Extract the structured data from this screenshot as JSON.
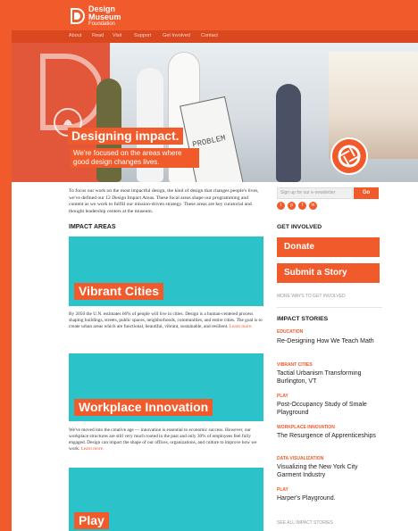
{
  "brand": {
    "logo_line1": "Design",
    "logo_line2": "Museum",
    "logo_line3": "Foundation",
    "accent": "#f15a2a",
    "teal": "#2bc3c9"
  },
  "nav": {
    "items": [
      "About",
      "Read",
      "Visit",
      "Support",
      "Get Involved",
      "Contact"
    ]
  },
  "hero": {
    "title": "Designing impact.",
    "subtitle": "We're focused on the areas where good design changes lives.",
    "board_text": "PROBLEM"
  },
  "intro": "To focus our work on the most impactful design, the kind of design that changes people's lives, we've defined our 12 Design Impact Areas. These focal areas shape our programming and content as we work to fulfill our mission-driven strategy. These areas are key curatorial and thought leadership centers at the museum.",
  "impact": {
    "heading": "IMPACT AREAS",
    "cards": [
      {
        "title": "Vibrant Cities",
        "text": "By 2050 the U.N. estimates 66% of people will live in cities. Design is a human-centered process shaping buildings, streets, public spaces, neighborhoods, communities, and entire cities. The goal is to create urban areas which are functional, beautiful, vibrant, sustainable, and resilient.",
        "link": "Learn more."
      },
      {
        "title": "Workplace Innovation",
        "text": "We've moved into the creative age — innovation is essential to economic success. However, our workplace structures are still very much rooted in the past and only 30% of employees feel fully engaged. Design can impact the shape of our offices, organizations, and culture to improve how we work.",
        "link": "Learn more."
      },
      {
        "title": "Play",
        "text": "",
        "link": ""
      }
    ]
  },
  "sidebar": {
    "newsletter_placeholder": "Sign up for our e-newsletter",
    "go_label": "Go",
    "social": [
      "t",
      "p",
      "f",
      "in"
    ],
    "get_involved": "GET INVOLVED",
    "donate": "Donate",
    "submit": "Submit a Story",
    "more_ways": "MORE WAYS TO GET INVOLVED",
    "stories_heading": "IMPACT STORIES",
    "stories": [
      {
        "category": "EDUCATION",
        "title": "Re-Designing How We Teach Math"
      },
      {
        "category": "VIBRANT CITIES",
        "title": "Tactial Urbanism Transforming Burlington, VT"
      },
      {
        "category": "PLAY",
        "title": "Post-Occupancy Study of Smale Playground"
      },
      {
        "category": "WORKPLACE INNOVATION",
        "title": "The Resurgence of Apprenticeships"
      },
      {
        "category": "DATA VISUALIZATION",
        "title": "Visualizing the New York City Garment Industry"
      },
      {
        "category": "PLAY",
        "title": "Harper's Playground."
      }
    ],
    "see_all": "SEE ALL IMPACT STORIES"
  }
}
